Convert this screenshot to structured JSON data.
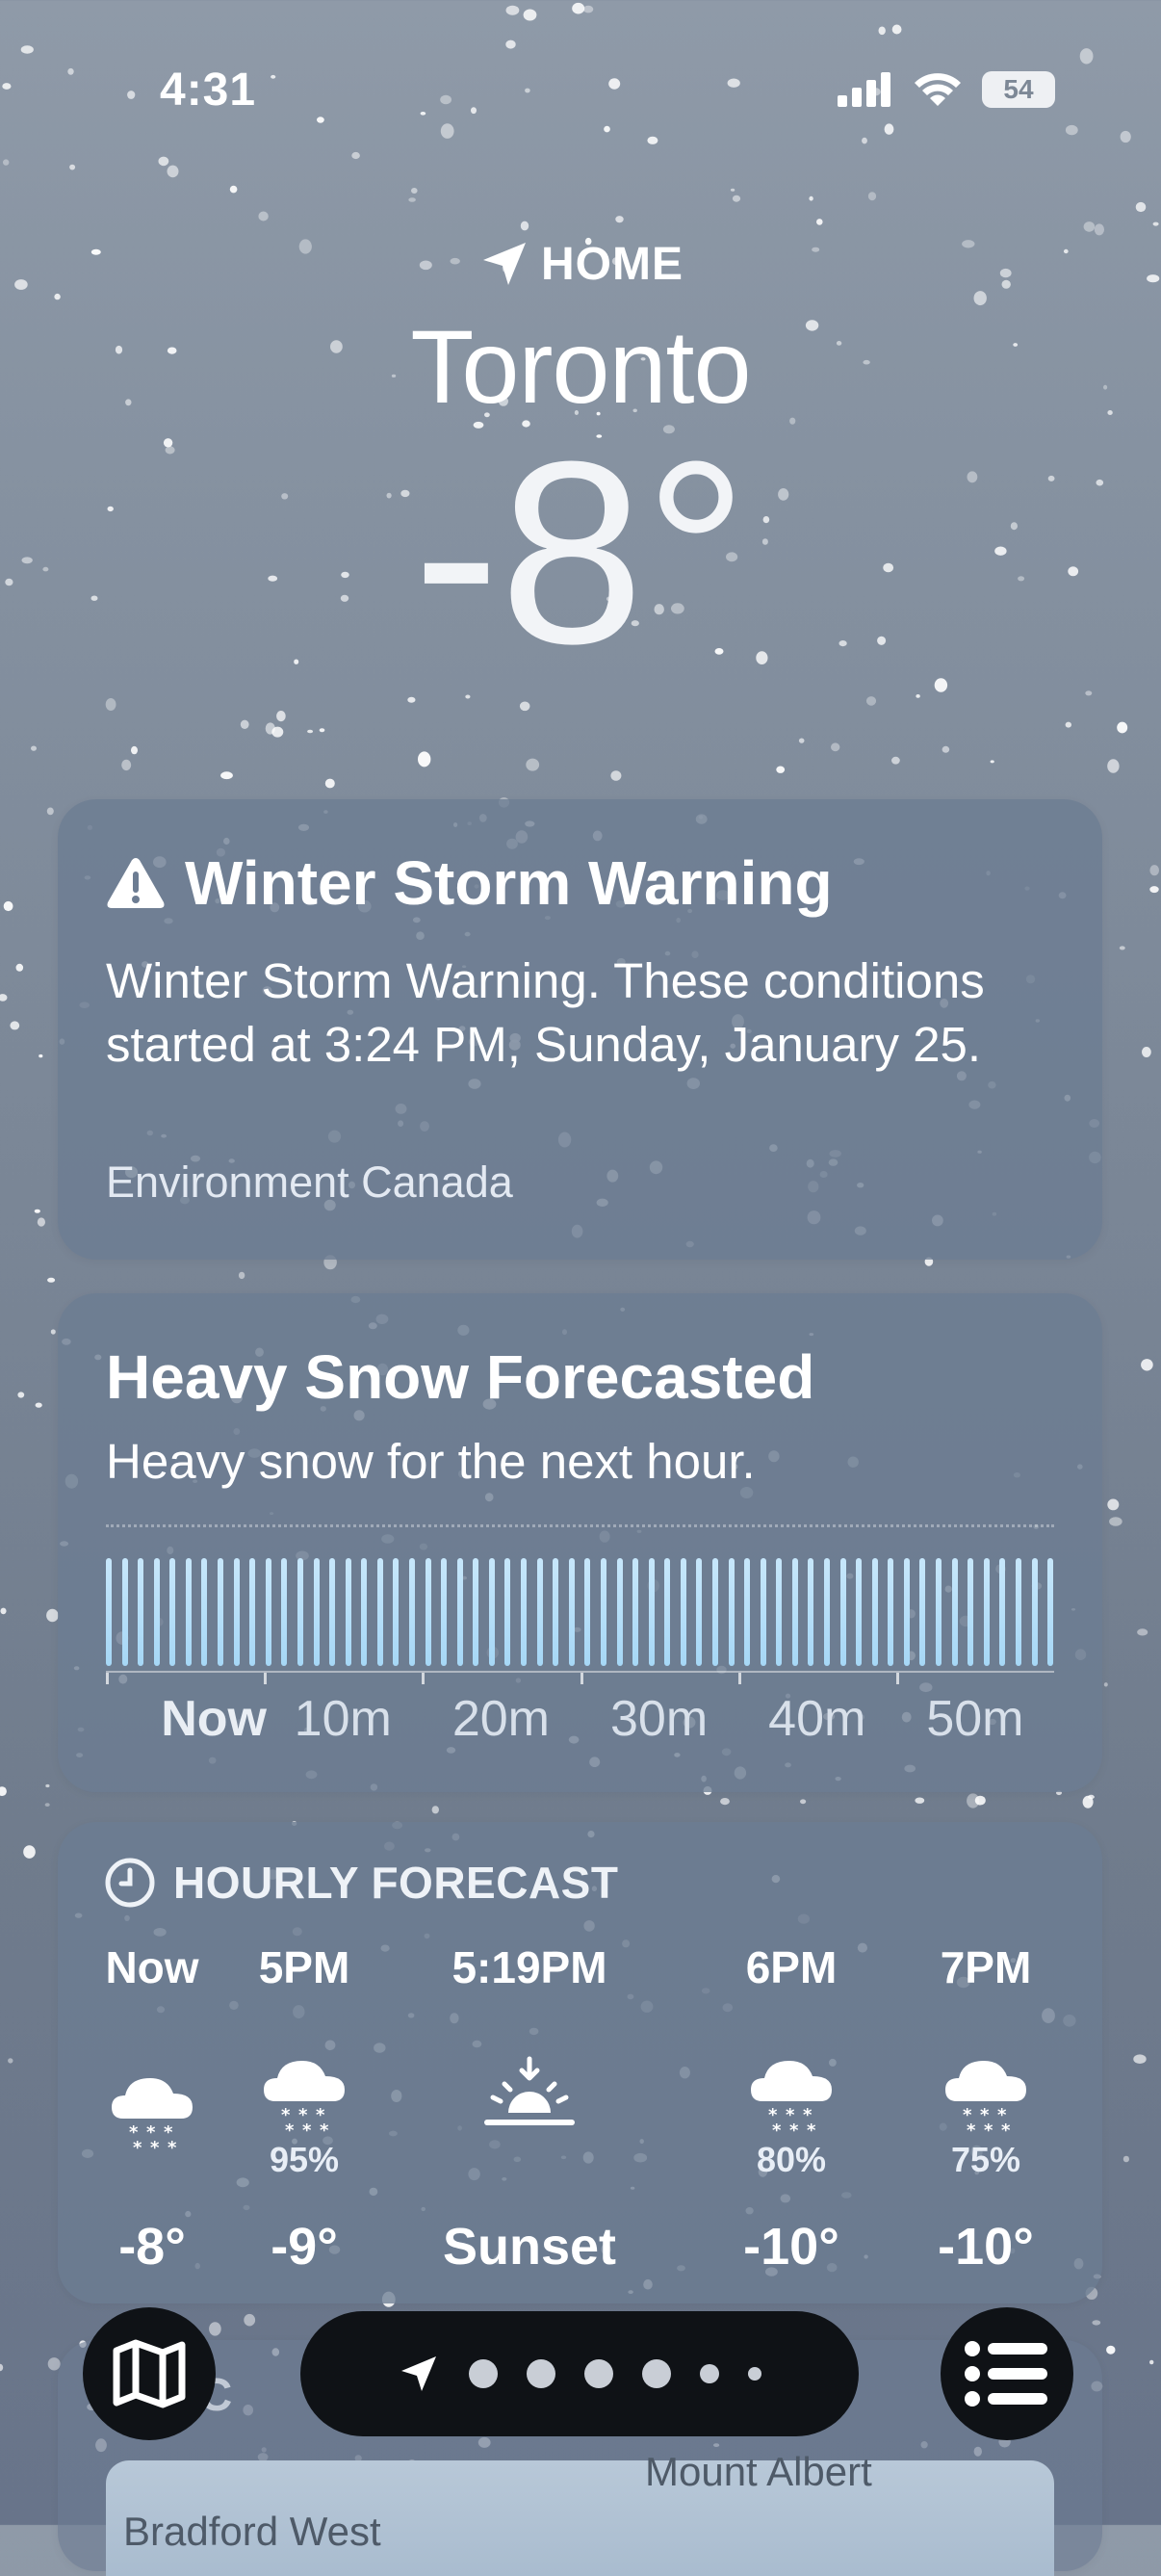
{
  "status": {
    "time": "4:31",
    "battery": "54"
  },
  "header": {
    "location_label": "HOME",
    "city": "Toronto",
    "temperature": "-8°"
  },
  "warning": {
    "title": "Winter Storm Warning",
    "text": "Winter Storm Warning. These conditions started at 3:24 PM, Sunday, January 25.",
    "source": "Environment Canada"
  },
  "snow_forecast": {
    "title": "Heavy Snow Forecasted",
    "subtitle": "Heavy snow for the next hour.",
    "intensity_per_minute": 1.0,
    "minutes_shown": 60,
    "time_labels": [
      "Now",
      "10m",
      "20m",
      "30m",
      "40m",
      "50m"
    ]
  },
  "hourly": {
    "header": "HOURLY FORECAST",
    "items": [
      {
        "time": "Now",
        "icon": "snow-icon",
        "precip": "",
        "temp": "-8°"
      },
      {
        "time": "5PM",
        "icon": "snow-icon",
        "precip": "95%",
        "temp": "-9°"
      },
      {
        "time": "5:19PM",
        "icon": "sunset-icon",
        "precip": "",
        "temp": "Sunset"
      },
      {
        "time": "6PM",
        "icon": "snow-icon",
        "precip": "80%",
        "temp": "-10°"
      },
      {
        "time": "7PM",
        "icon": "snow-icon",
        "precip": "75%",
        "temp": "-10°"
      }
    ]
  },
  "radar": {
    "label": "REC",
    "places": [
      "Bradford West",
      "Mount Albert"
    ]
  },
  "bottom_bar": {
    "page_count": 7,
    "current_page": 0
  },
  "colors": {
    "card": "#6c7c92",
    "snow_bar": "#b3ddf8",
    "button_bg": "#0f1216"
  }
}
